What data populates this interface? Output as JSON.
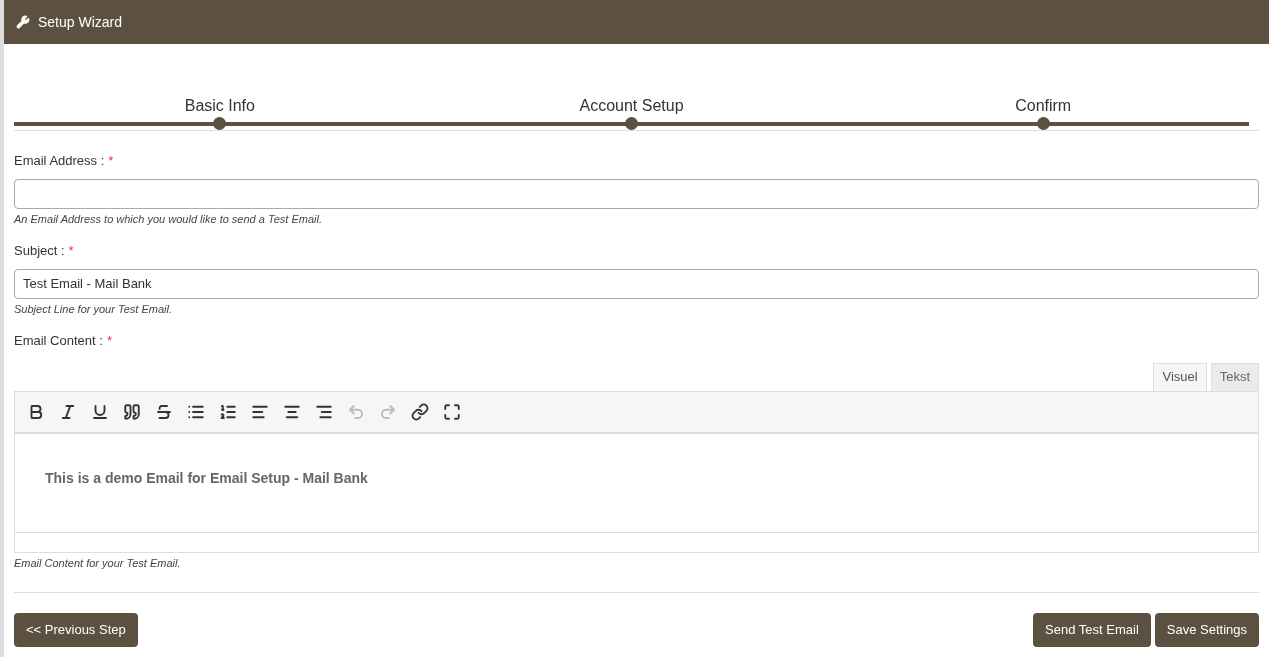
{
  "header": {
    "title": "Setup Wizard"
  },
  "steps": [
    {
      "label": "Basic Info"
    },
    {
      "label": "Account Setup"
    },
    {
      "label": "Confirm"
    }
  ],
  "fields": [
    {
      "label": "Email Address :",
      "required": "*",
      "hint": "An Email Address to which you would like to send a Test Email."
    },
    {
      "label": "Subject :",
      "required": "*",
      "value": "Test Email - Mail Bank",
      "hint": "Subject Line for your Test Email."
    }
  ],
  "editor": {
    "label": "Email Content :",
    "required": "*",
    "tabs": [
      {
        "label": "Visuel",
        "selected": true
      },
      {
        "label": "Tekst",
        "selected": false
      }
    ],
    "toolbar": [
      {
        "kind": "bold",
        "disabled": false
      },
      {
        "kind": "italic",
        "disabled": false
      },
      {
        "kind": "underline",
        "disabled": false
      },
      {
        "kind": "quote",
        "disabled": false
      },
      {
        "kind": "strike",
        "disabled": false
      },
      {
        "kind": "bullets",
        "disabled": false
      },
      {
        "kind": "numbers",
        "disabled": false
      },
      {
        "kind": "align-left",
        "disabled": false
      },
      {
        "kind": "align-center",
        "disabled": false
      },
      {
        "kind": "align-right",
        "disabled": false
      },
      {
        "kind": "undo",
        "disabled": true
      },
      {
        "kind": "redo",
        "disabled": true
      },
      {
        "kind": "link",
        "disabled": false
      },
      {
        "kind": "fullscreen",
        "disabled": false
      }
    ],
    "content": "This is a demo Email for Email Setup - Mail Bank",
    "hint": "Email Content for your Test Email."
  },
  "buttons": {
    "left": [
      "<< Previous Step"
    ],
    "right": [
      "Send Test Email",
      "Save Settings"
    ]
  }
}
